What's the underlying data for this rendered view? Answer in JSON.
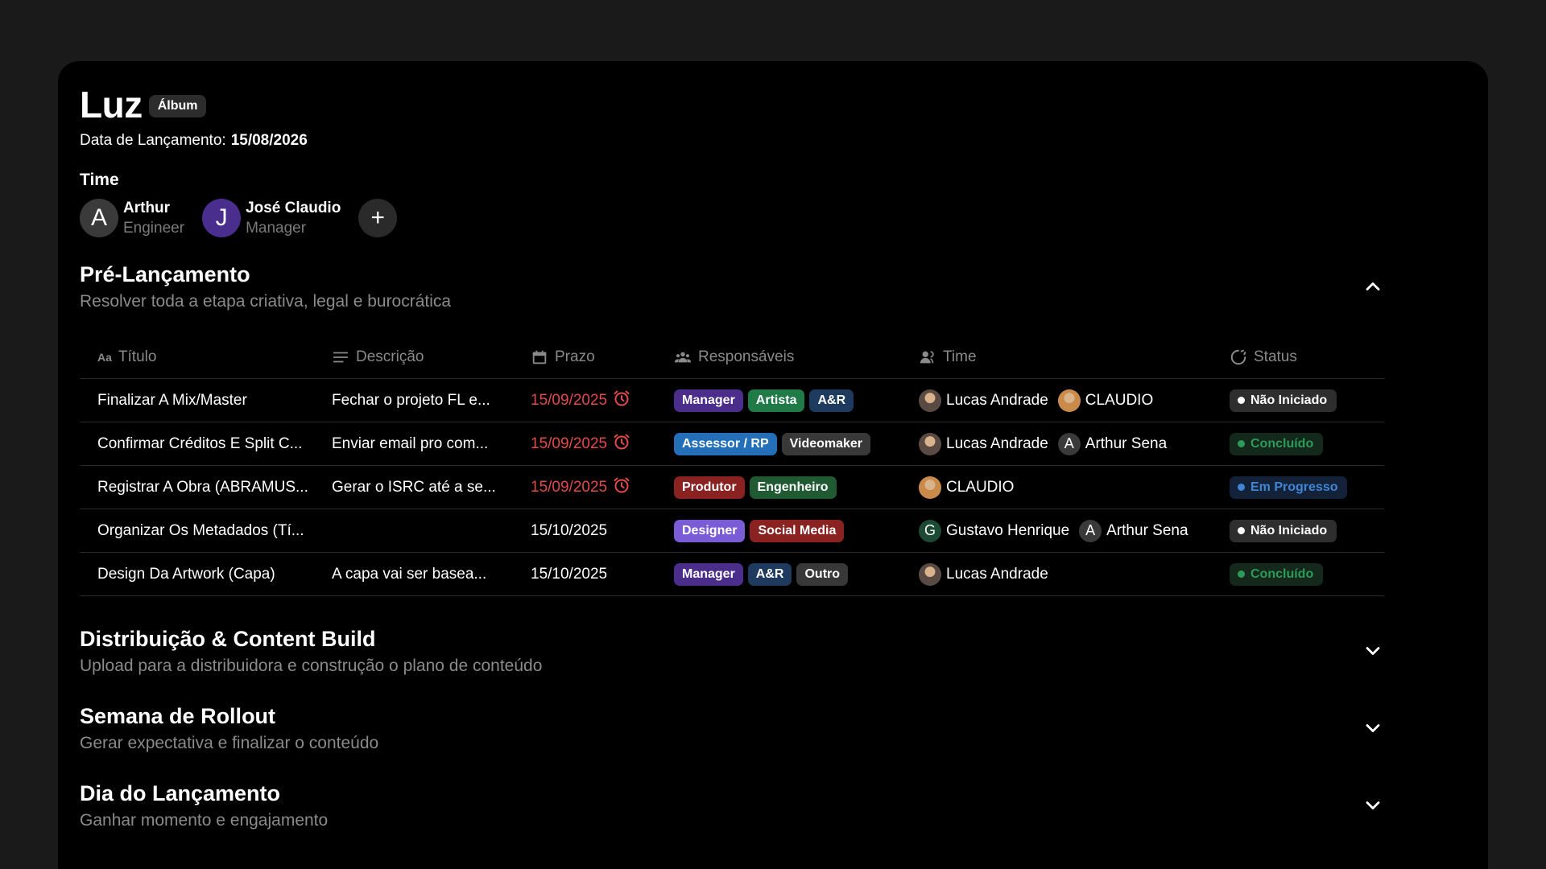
{
  "album": {
    "title": "Luz",
    "type_badge": "Álbum",
    "release_label": "Data de Lançamento:",
    "release_date": "15/08/2026"
  },
  "team": {
    "heading": "Time",
    "members": [
      {
        "initial": "A",
        "name": "Arthur",
        "role": "Engineer",
        "color": "#3a3a3a"
      },
      {
        "initial": "J",
        "name": "José Claudio",
        "role": "Manager",
        "color": "#4a2e8e"
      }
    ],
    "add_label": "+"
  },
  "sections": [
    {
      "title": "Pré-Lançamento",
      "subtitle": "Resolver toda a etapa criativa, legal e burocrática",
      "expanded": true,
      "icon": "chevron-up-icon"
    },
    {
      "title": "Distribuição & Content Build",
      "subtitle": "Upload para a distribuidora e construção o plano de conteúdo",
      "expanded": false,
      "icon": "chevron-down-icon"
    },
    {
      "title": "Semana de Rollout",
      "subtitle": "Gerar expectativa e finalizar o conteúdo",
      "expanded": false,
      "icon": "chevron-down-icon"
    },
    {
      "title": "Dia do Lançamento",
      "subtitle": "Ganhar momento e engajamento",
      "expanded": false,
      "icon": "chevron-down-icon"
    }
  ],
  "table": {
    "columns": [
      {
        "label": "Título",
        "icon": "Aa"
      },
      {
        "label": "Descrição",
        "icon": "lines-icon"
      },
      {
        "label": "Prazo",
        "icon": "calendar-icon"
      },
      {
        "label": "Responsáveis",
        "icon": "people-icon"
      },
      {
        "label": "Time",
        "icon": "person-icon"
      },
      {
        "label": "Status",
        "icon": "status-icon"
      }
    ],
    "rows": [
      {
        "title": "Finalizar A Mix/Master",
        "description": "Fechar o projeto FL e...",
        "due": "15/09/2025",
        "overdue": true,
        "tags": [
          {
            "label": "Manager",
            "color": "#4b2e8c"
          },
          {
            "label": "Artista",
            "color": "#1f7a48"
          },
          {
            "label": "A&R",
            "color": "#1e3a5f"
          }
        ],
        "people": [
          {
            "name": "Lucas Andrade",
            "initial": "",
            "color": "#5a4a44"
          },
          {
            "name": "CLAUDIO",
            "initial": "",
            "color": "#c98a4a"
          }
        ],
        "status": {
          "label": "Não Iniciado",
          "bg": "#2e2e2e",
          "fg": "#ffffff",
          "dot": "#ffffff"
        }
      },
      {
        "title": "Confirmar Créditos E Split C...",
        "description": "Enviar email pro com...",
        "due": "15/09/2025",
        "overdue": true,
        "tags": [
          {
            "label": "Assessor / RP",
            "color": "#2470b8"
          },
          {
            "label": "Videomaker",
            "color": "#383838"
          }
        ],
        "people": [
          {
            "name": "Lucas Andrade",
            "initial": "",
            "color": "#5a4a44"
          },
          {
            "name": "Arthur Sena",
            "initial": "A",
            "color": "#3a3a3a"
          }
        ],
        "status": {
          "label": "Concluído",
          "bg": "#14281c",
          "fg": "#2e9a58",
          "dot": "#2e9a58"
        }
      },
      {
        "title": "Registrar A Obra (ABRAMUS...",
        "description": "Gerar o ISRC até a se...",
        "due": "15/09/2025",
        "overdue": true,
        "tags": [
          {
            "label": "Produtor",
            "color": "#8a2222"
          },
          {
            "label": "Engenheiro",
            "color": "#1f5a32"
          }
        ],
        "people": [
          {
            "name": "CLAUDIO",
            "initial": "",
            "color": "#c98a4a"
          }
        ],
        "status": {
          "label": "Em Progresso",
          "bg": "#132238",
          "fg": "#3f86d6",
          "dot": "#3f86d6"
        }
      },
      {
        "title": "Organizar Os Metadados (Tí...",
        "description": "",
        "due": "15/10/2025",
        "overdue": false,
        "tags": [
          {
            "label": "Designer",
            "color": "#7a5cd6"
          },
          {
            "label": "Social Media",
            "color": "#8a2222"
          }
        ],
        "people": [
          {
            "name": "Gustavo Henrique",
            "initial": "G",
            "color": "#1d4a34"
          },
          {
            "name": "Arthur Sena",
            "initial": "A",
            "color": "#3a3a3a"
          }
        ],
        "status": {
          "label": "Não Iniciado",
          "bg": "#2e2e2e",
          "fg": "#ffffff",
          "dot": "#ffffff"
        }
      },
      {
        "title": "Design Da Artwork (Capa)",
        "description": "A capa vai ser basea...",
        "due": "15/10/2025",
        "overdue": false,
        "tags": [
          {
            "label": "Manager",
            "color": "#4b2e8c"
          },
          {
            "label": "A&R",
            "color": "#1e3a5f"
          },
          {
            "label": "Outro",
            "color": "#383838"
          }
        ],
        "people": [
          {
            "name": "Lucas Andrade",
            "initial": "",
            "color": "#5a4a44"
          }
        ],
        "status": {
          "label": "Concluído",
          "bg": "#14281c",
          "fg": "#2e9a58",
          "dot": "#2e9a58"
        }
      }
    ]
  }
}
